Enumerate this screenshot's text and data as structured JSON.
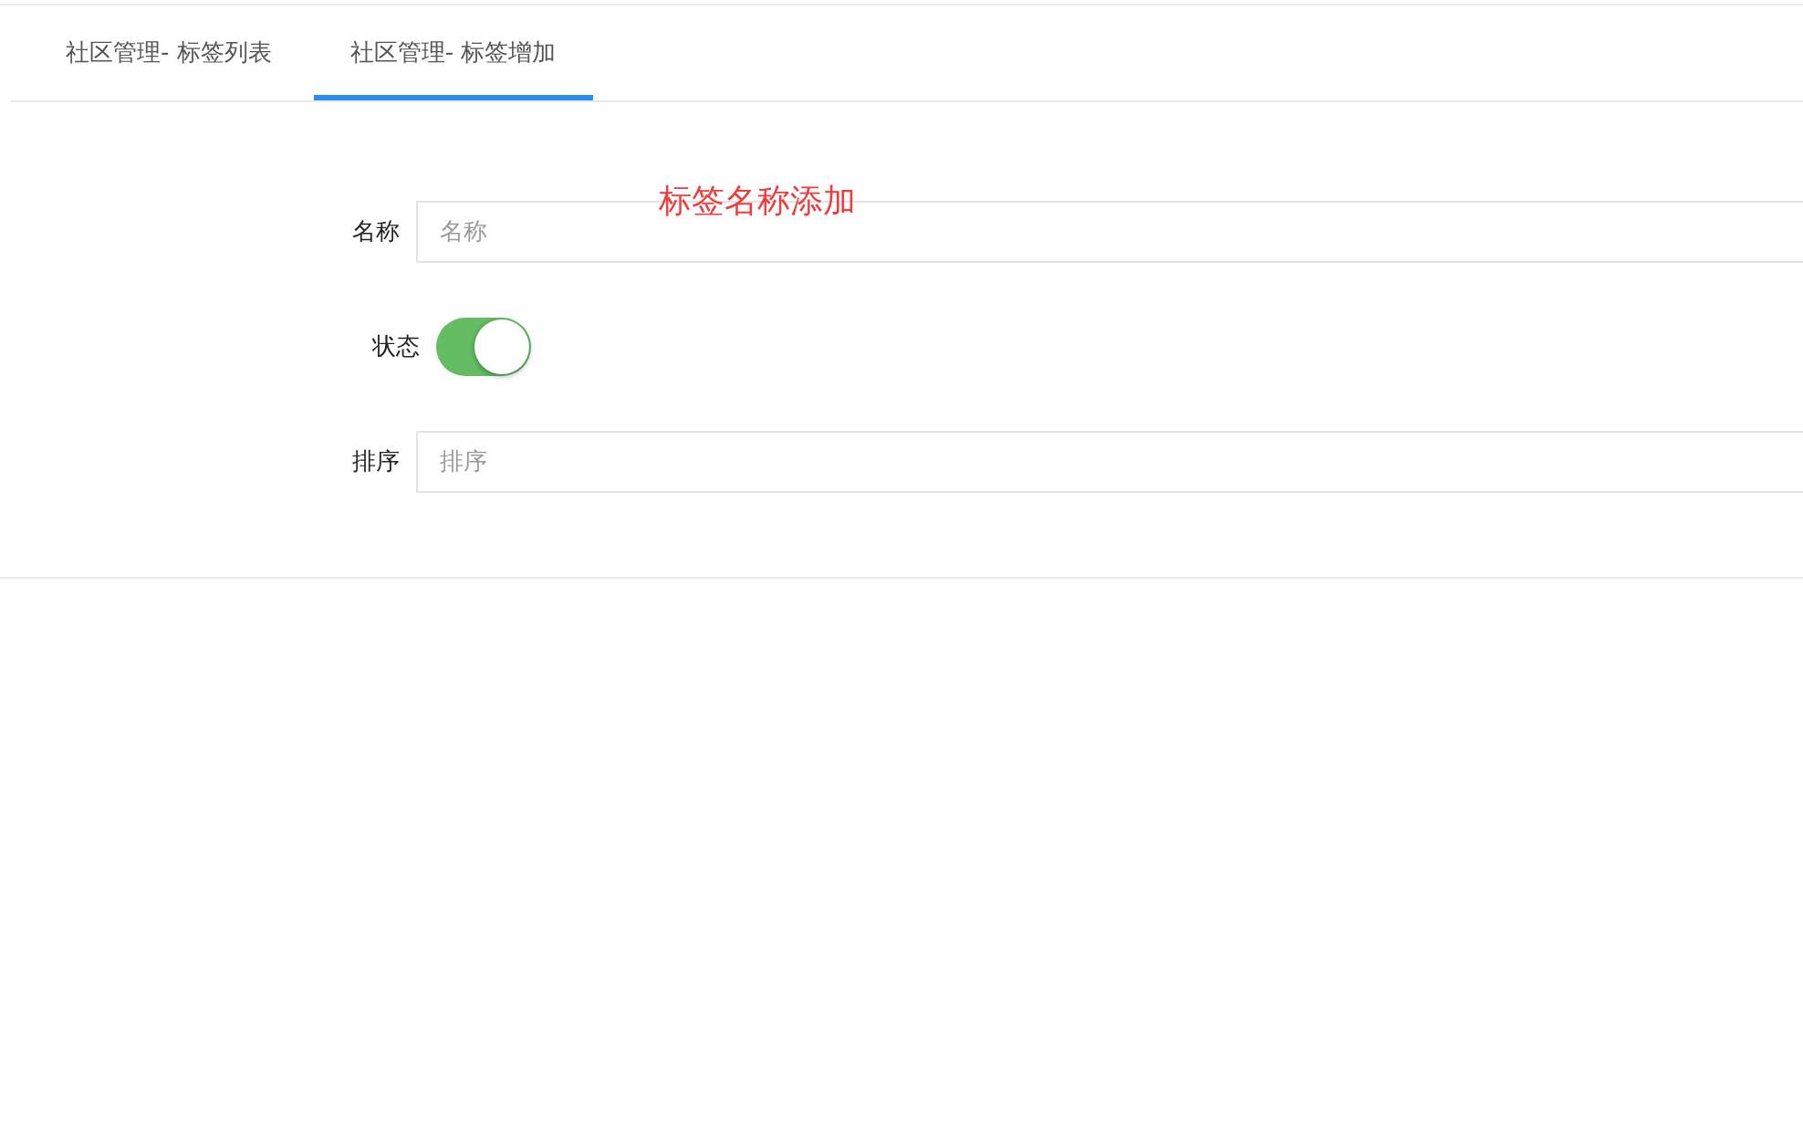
{
  "tabs": [
    {
      "label": "社区管理- 标签列表",
      "selected": false
    },
    {
      "label": "社区管理- 标签增加",
      "selected": true
    }
  ],
  "annotation": "标签名称添加",
  "form": {
    "fields": [
      {
        "kind": "input",
        "label": "名称",
        "placeholder": "名称"
      },
      {
        "kind": "switch",
        "label": "状态",
        "on": true
      },
      {
        "kind": "input",
        "label": "排序",
        "placeholder": "排序"
      }
    ]
  }
}
